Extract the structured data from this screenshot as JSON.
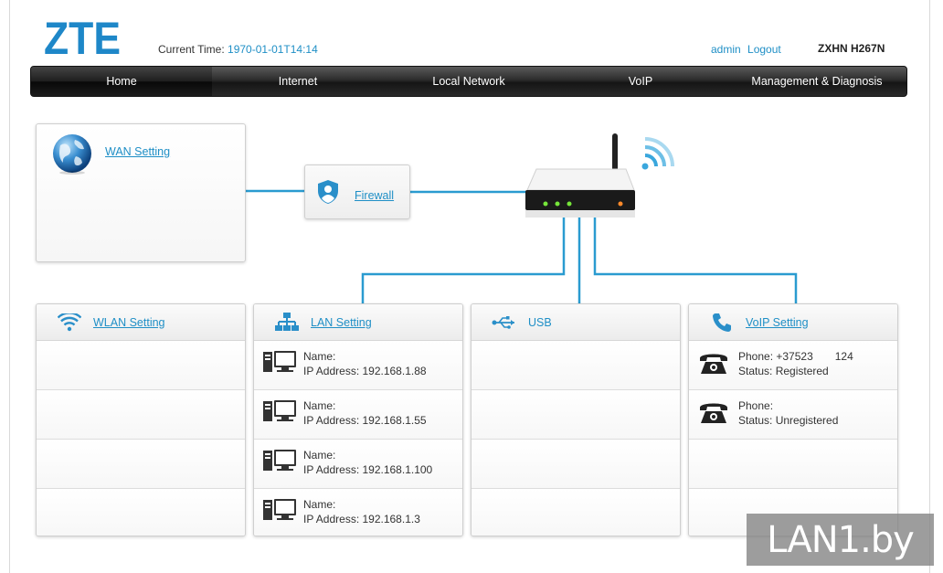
{
  "header": {
    "brand": "ZTE",
    "time_label": "Current Time:",
    "time_value": "1970-01-01T14:14",
    "user": "admin",
    "logout": "Logout",
    "model": "ZXHN H267N"
  },
  "nav": [
    {
      "label": "Home",
      "active": true
    },
    {
      "label": "Internet"
    },
    {
      "label": "Local Network"
    },
    {
      "label": "VoIP"
    },
    {
      "label": "Management & Diagnosis"
    }
  ],
  "topology": {
    "wan": {
      "label": "WAN Setting",
      "icon": "globe-icon"
    },
    "firewall": {
      "label": "Firewall",
      "icon": "shield-icon"
    }
  },
  "panels": {
    "wlan": {
      "title": "WLAN Setting",
      "icon": "wifi-icon"
    },
    "lan": {
      "title": "LAN Setting",
      "icon": "network-icon",
      "devices": [
        {
          "name": "Name:",
          "ip": "IP Address: 192.168.1.88"
        },
        {
          "name": "Name:",
          "ip": "IP Address: 192.168.1.55"
        },
        {
          "name": "Name:",
          "ip": "IP Address: 192.168.1.100"
        },
        {
          "name": "Name:",
          "ip": "IP Address: 192.168.1.3"
        }
      ]
    },
    "usb": {
      "title": "USB",
      "icon": "usb-icon"
    },
    "voip": {
      "title": "VoIP Setting",
      "icon": "phone-icon",
      "lines": [
        {
          "phone": "Phone: +37523  124",
          "status": "Status: Registered"
        },
        {
          "phone": "Phone:",
          "status": "Status: Unregistered"
        }
      ]
    }
  },
  "watermark": "LAN1.by",
  "colors": {
    "accent": "#1f8fc6",
    "line": "#2a9bd0",
    "nav_bg": "#2c2c2c"
  }
}
